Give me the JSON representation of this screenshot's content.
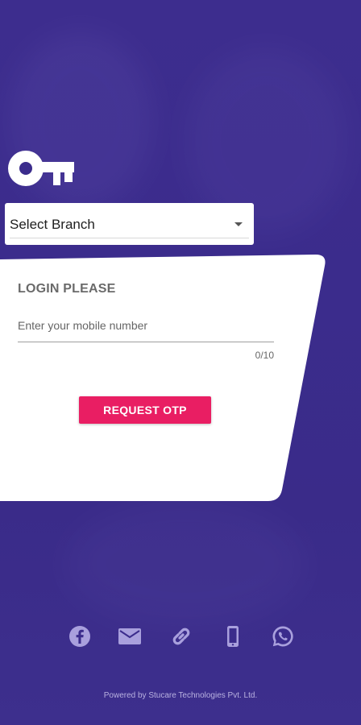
{
  "branch_select": {
    "value": "Select Branch"
  },
  "login_card": {
    "title": "LOGIN PLEASE",
    "mobile_placeholder": "Enter your mobile number",
    "mobile_value": "",
    "counter": "0/10",
    "request_button_label": "REQUEST OTP"
  },
  "social": {
    "icons": [
      "facebook-icon",
      "mail-icon",
      "link-icon",
      "phone-icon",
      "whatsapp-icon"
    ]
  },
  "footer": {
    "text": "Powered by Stucare Technologies Pvt. Ltd."
  },
  "colors": {
    "background": "#3b2c8c",
    "card": "#ffffff",
    "accent": "#e91e63",
    "icon_tint": "#a9a0dd"
  }
}
